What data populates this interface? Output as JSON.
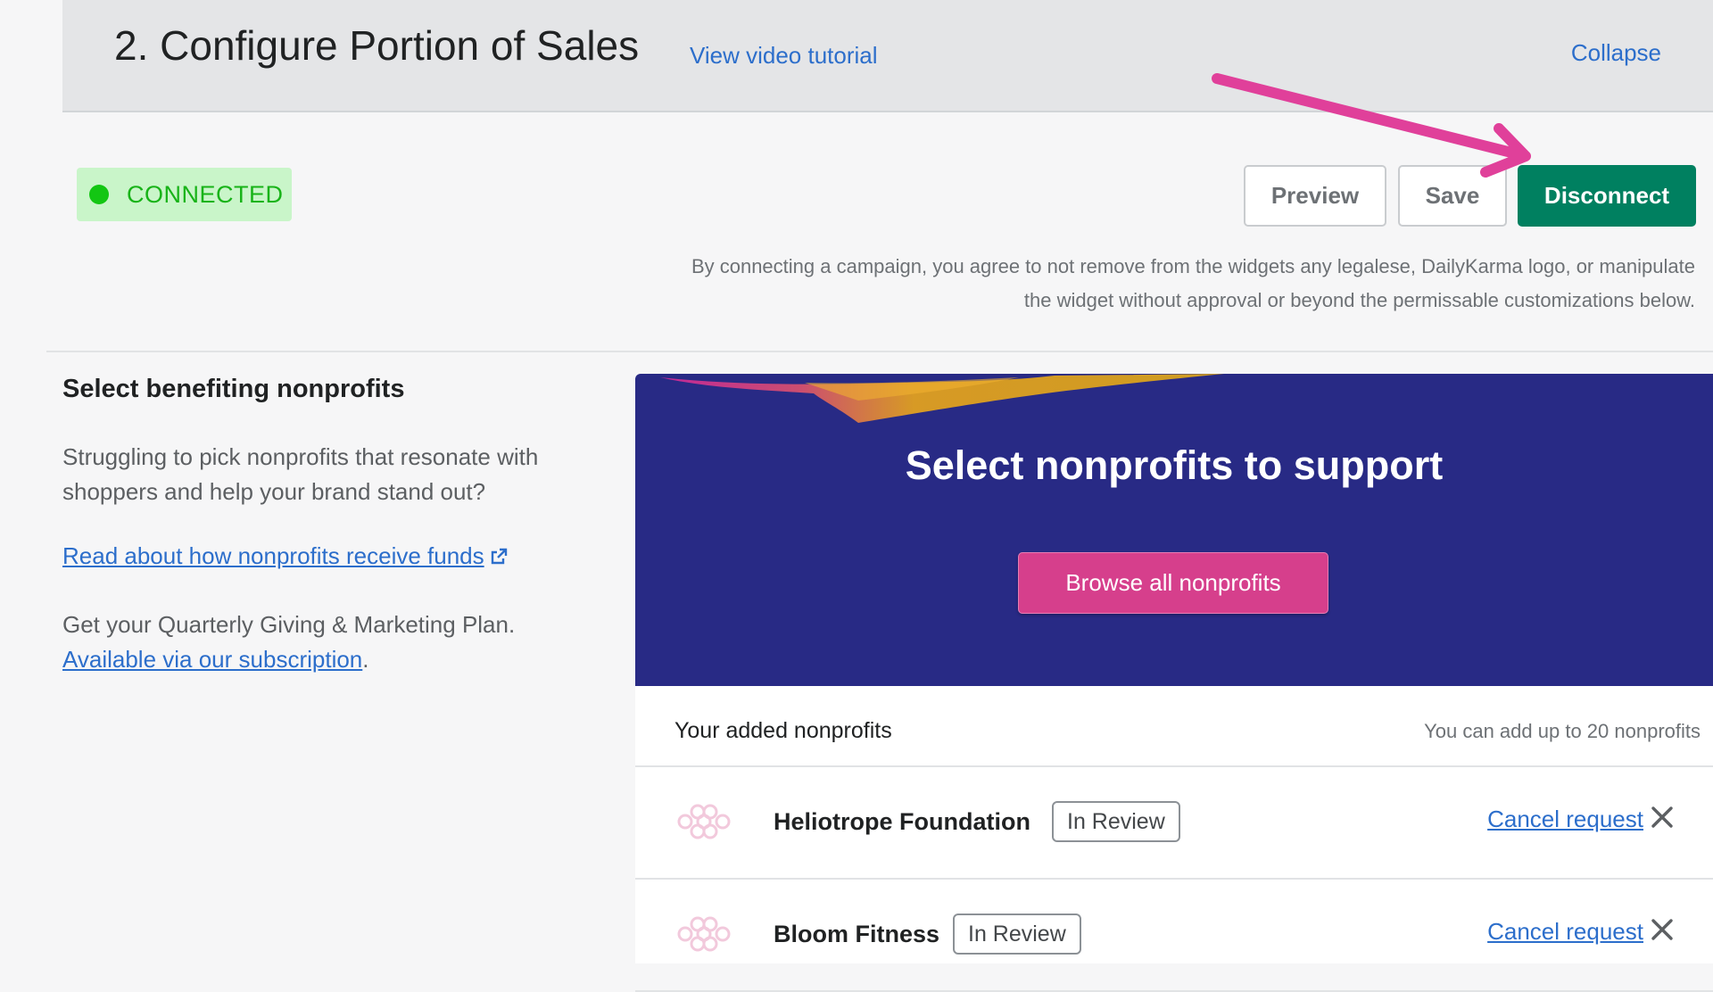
{
  "section": {
    "title": "2. Configure Portion of Sales",
    "video_link": "View video tutorial",
    "collapse_link": "Collapse"
  },
  "status": {
    "label": "CONNECTED",
    "color": "#13c613"
  },
  "actions": {
    "preview": "Preview",
    "save": "Save",
    "disconnect": "Disconnect"
  },
  "legal_text": "By connecting a campaign, you agree to not remove from the widgets any legalese, DailyKarma logo, or manipulate the widget without approval or beyond the permissable customizations below.",
  "sidebar": {
    "heading": "Select benefiting nonprofits",
    "description": "Struggling to pick nonprofits that resonate with shoppers and help your brand stand out?",
    "funds_link": "Read about how nonprofits receive funds",
    "plan_text": "Get your Quarterly Giving & Marketing Plan.",
    "subscription_link": "Available via our subscription",
    "subscription_suffix": "."
  },
  "banner": {
    "title": "Select nonprofits to support",
    "browse_button": "Browse all nonprofits",
    "background_color": "#282a85",
    "button_color": "#d63f8c"
  },
  "nonprofit_list": {
    "title": "Your added nonprofits",
    "limit_text": "You can add up to 20 nonprofits",
    "items": [
      {
        "name": "Heliotrope Foundation",
        "status": "In Review",
        "action": "Cancel request"
      },
      {
        "name": "Bloom Fitness",
        "status": "In Review",
        "action": "Cancel request"
      }
    ]
  },
  "colors": {
    "primary_green": "#008060",
    "link_blue": "#2c6ecb",
    "annotation_arrow": "#e0409a"
  }
}
